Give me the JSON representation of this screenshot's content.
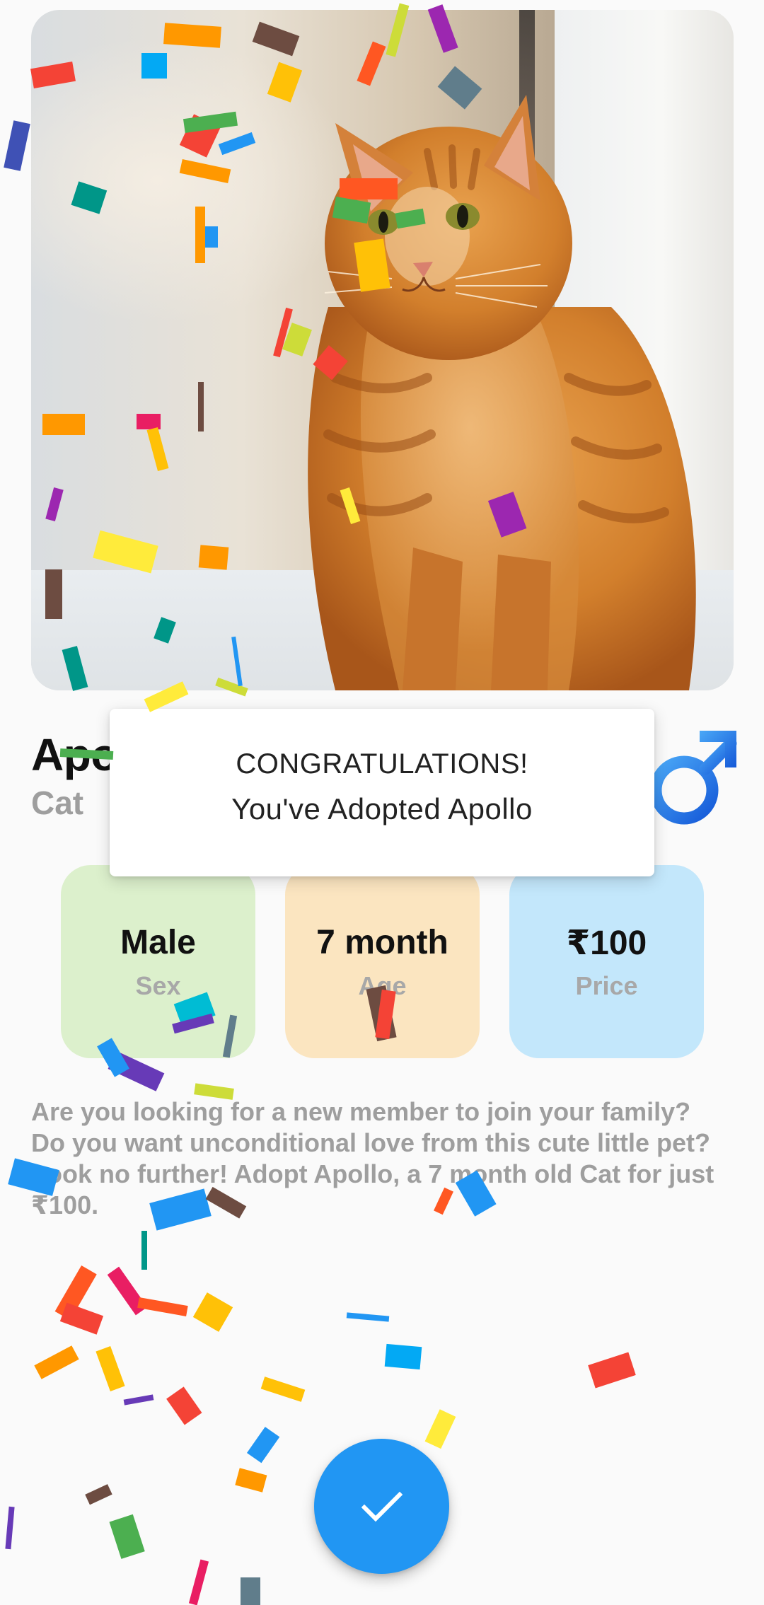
{
  "pet": {
    "name": "Apollo",
    "type": "Cat"
  },
  "stats": {
    "sex": {
      "value": "Male",
      "label": "Sex"
    },
    "age": {
      "value": "7 month",
      "label": "Age"
    },
    "price": {
      "value": "₹100",
      "label": "Price"
    }
  },
  "description": "Are you looking for a new member to join your family? Do you want unconditional love from this cute little pet? Look no further! Adopt Apollo, a 7 month old Cat for just ₹100.",
  "dialog": {
    "line1": "CONGRATULATIONS!",
    "line2": "You've Adopted Apollo"
  },
  "icons": {
    "gender": "male-icon",
    "fab": "check-icon"
  },
  "colors": {
    "accent": "#2196f3",
    "sex_card": "#dcf0cc",
    "age_card": "#fbe5c0",
    "price_card": "#c3e7fb"
  }
}
